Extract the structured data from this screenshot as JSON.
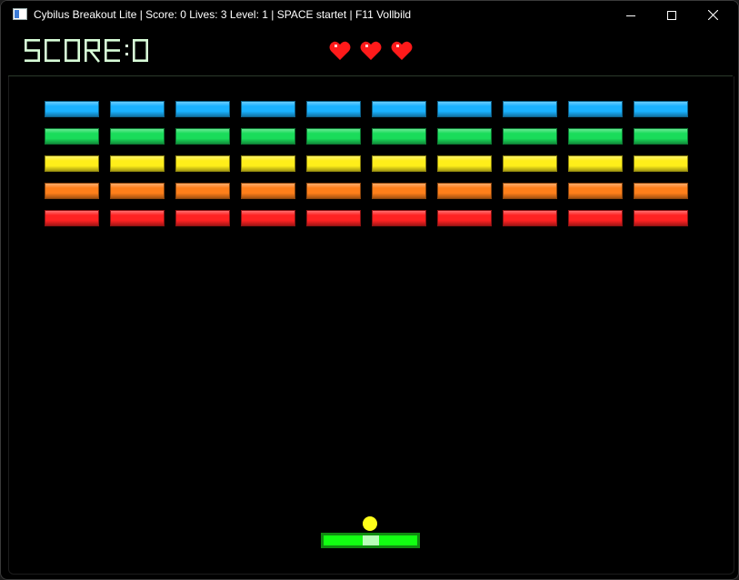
{
  "window": {
    "title": "Cybilus Breakout Lite  |  Score: 0  Lives: 3  Level: 1  |  SPACE startet  |  F11 Vollbild",
    "icon": "window-app-icon",
    "controls": [
      "minimize-icon",
      "maximize-icon",
      "close-icon"
    ]
  },
  "hud": {
    "score_text": "SCORE:0",
    "score": 0,
    "lives": 3,
    "score_color": "#d9ffd9",
    "heart_color": "#ff1a1a"
  },
  "bricks": {
    "rows": [
      {
        "color": "cyan",
        "hex": "#1ab2ff",
        "count": 10
      },
      {
        "color": "green",
        "hex": "#1adc5a",
        "count": 10
      },
      {
        "color": "yellow",
        "hex": "#ffee1a",
        "count": 10
      },
      {
        "color": "orange",
        "hex": "#ff7f1a",
        "count": 10
      },
      {
        "color": "red",
        "hex": "#ff2222",
        "count": 10
      }
    ]
  },
  "paddle": {
    "color": "#12ff12"
  },
  "ball": {
    "color": "#ffff1a"
  },
  "background": "#000000"
}
